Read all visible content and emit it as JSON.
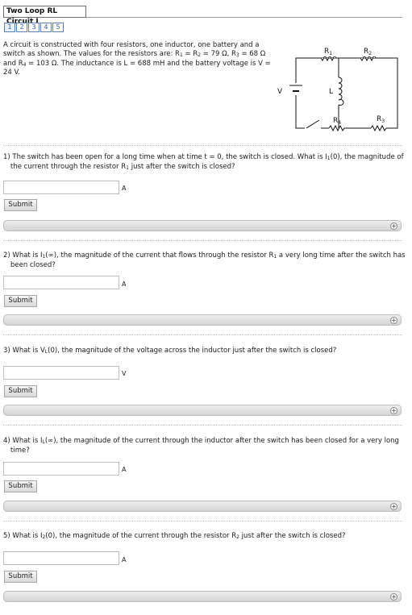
{
  "header": {
    "title": "Two Loop RL Circuit I",
    "pages": [
      "1",
      "2",
      "3",
      "4",
      "5"
    ]
  },
  "intro": {
    "line1": "A circuit is constructed with four resistors, one inductor, one battery and a",
    "line2_a": "switch as shown. The values for the resistors are: R",
    "line2_b": " = R",
    "line2_c": " = 79 Ω, R",
    "line2_d": " = 68 Ω",
    "line3_a": "and R",
    "line3_b": " = 103 Ω. The inductance is L = 688 mH and the battery voltage is V =",
    "line4": "24 V."
  },
  "circuit": {
    "r1": "R",
    "r1_sub": "1",
    "r2": "R",
    "r2_sub": "2",
    "r3": "R",
    "r3_sub": "3",
    "r4": "R",
    "r4_sub": "4",
    "inductor": "L",
    "battery": "V"
  },
  "questions": [
    {
      "a": "1) The switch has been open for a long time when at time t = 0, the switch is closed. What is I",
      "sub1": "1",
      "b": "(0), the magnitude of the current through the resistor R",
      "sub2": "1",
      "c": " just after the switch is closed?",
      "value": "",
      "unit": "A",
      "submit": "Submit"
    },
    {
      "a": "2) What is I",
      "sub1": "1",
      "b": "(∞), the magnitude of the current that flows through the resistor R",
      "sub2": "1",
      "c": " a very long time after the switch has been closed?",
      "value": "",
      "unit": "A",
      "submit": "Submit"
    },
    {
      "a": "3) What is V",
      "sub1": "L",
      "b": "(0), the magnitude of the voltage across the inductor just after the switch is closed?",
      "value": "",
      "unit": "V",
      "submit": "Submit"
    },
    {
      "a": "4) What is I",
      "sub1": "L",
      "b": "(∞), the magnitude of the current through the inductor after the switch has been closed for a very long time?",
      "value": "",
      "unit": "A",
      "submit": "Submit"
    },
    {
      "a": "5) What is I",
      "sub1": "2",
      "b": "(0), the magnitude of the current through the resistor R",
      "sub2": "2",
      "c": " just after the switch is closed?",
      "value": "",
      "unit": "A",
      "submit": "Submit"
    }
  ]
}
